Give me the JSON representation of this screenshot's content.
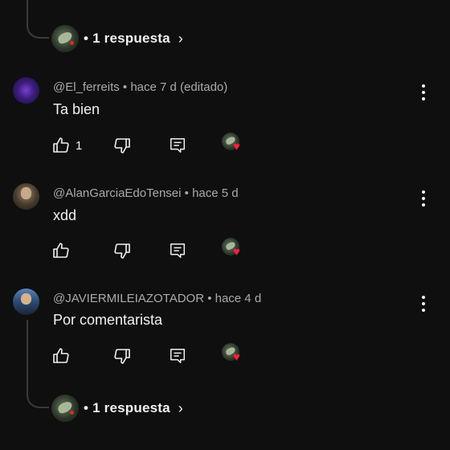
{
  "top_reply": {
    "label": "• 1 respuesta",
    "chevron": "›"
  },
  "comments": [
    {
      "author": "@El_ferreits",
      "meta_suffix": " • hace 7 d (editado)",
      "text": "Ta bien",
      "likes": "1"
    },
    {
      "author": "@AlanGarciaEdoTensei",
      "meta_suffix": " • hace 5 d",
      "text": "xdd",
      "likes": ""
    },
    {
      "author": "@JAVIERMILEIAZOTADOR",
      "meta_suffix": " • hace 4 d",
      "text": "Por comentarista",
      "likes": ""
    }
  ],
  "bottom_reply": {
    "label": "• 1 respuesta",
    "chevron": "›"
  },
  "icons": {
    "like": "thumbs-up-icon",
    "dislike": "thumbs-down-icon",
    "reply": "reply-icon",
    "creator_heart": "creator-heart-icon",
    "more": "more-vert-icon"
  },
  "colors": {
    "background": "#0f0f0f",
    "text": "#f1f1f1",
    "meta": "#aaaaaa",
    "heart": "#ff1f3a",
    "thread_line": "#3a3a3a"
  }
}
